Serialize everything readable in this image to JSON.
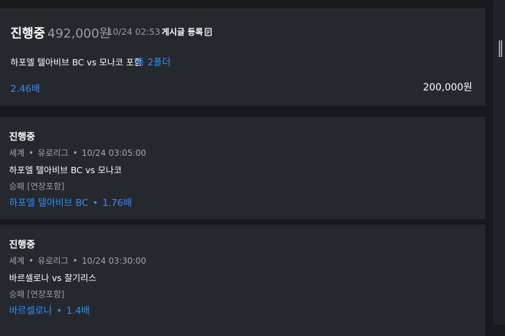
{
  "summary": {
    "status": "진행중",
    "bet_amount": "492,000원",
    "datetime": "10/24 02:53",
    "post_label": "게시글 등록",
    "post_icon": "memo-icon",
    "match": "하포엘 텔아비브 BC vs 모나코 포함",
    "folder_count": "총 2폴더",
    "total_odds": "2.46배",
    "expected_win": "200,000원"
  },
  "bets": [
    {
      "status": "진행중",
      "sport": "세계",
      "league": "유로리그",
      "datetime": "10/24 03:05:00",
      "match": "하포엘 텔아비브 BC vs 모나코",
      "market": "승패 [연장포함]",
      "pick": "하포엘 텔아비브 BC",
      "odds": "1.76배"
    },
    {
      "status": "진행중",
      "sport": "세계",
      "league": "유로리그",
      "datetime": "10/24 03:30:00",
      "match": "바르셀로나 vs 잘기리스",
      "market": "승패 [연장포함]",
      "pick": "바르셀로나",
      "odds": "1.4배"
    }
  ],
  "separator": "•",
  "colors": {
    "background": "#17191c",
    "card": "#25282c",
    "accent": "#2f8cff",
    "muted": "#9a9ea4"
  }
}
